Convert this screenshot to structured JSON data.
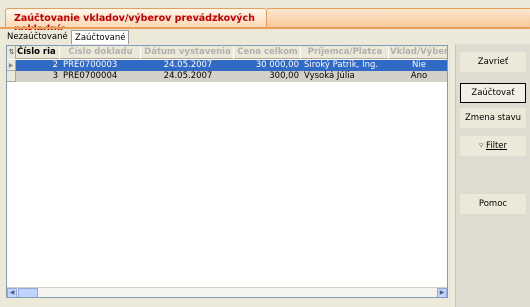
{
  "window": {
    "title": "Zaúčtovanie vkladov/výberov prevádzkových pokladníc"
  },
  "tabs": [
    {
      "label": "Nezaúčtované",
      "active": true
    },
    {
      "label": "Zaúčtované",
      "active": false
    }
  ],
  "grid": {
    "columns": [
      "Číslo ria",
      "Číslo dokladu",
      "Dátum vystavenia",
      "Cena celkom",
      "Príjemca/Platca",
      "Vklad/Výber"
    ],
    "rows": [
      {
        "cislo_riadku": "2",
        "cislo_dokladu": "PRE0700003",
        "datum": "24.05.2007",
        "cena": "30 000,00",
        "prijemca": "Široký Patrik, Ing.",
        "vklad_vyber": "Nie",
        "selected": true
      },
      {
        "cislo_riadku": "3",
        "cislo_dokladu": "PRE0700004",
        "datum": "24.05.2007",
        "cena": "300,00",
        "prijemca": "Vysoká Júlia",
        "vklad_vyber": "Áno",
        "selected": false
      }
    ]
  },
  "buttons": {
    "close": "Zavrieť",
    "post": "Zaúčtovať",
    "change_state": "Zmena stavu",
    "filter": "Filter",
    "help": "Pomoc"
  },
  "colors": {
    "title_text": "#c00000",
    "selection": "#316ac5",
    "accent_orange": "#e59f5a"
  }
}
